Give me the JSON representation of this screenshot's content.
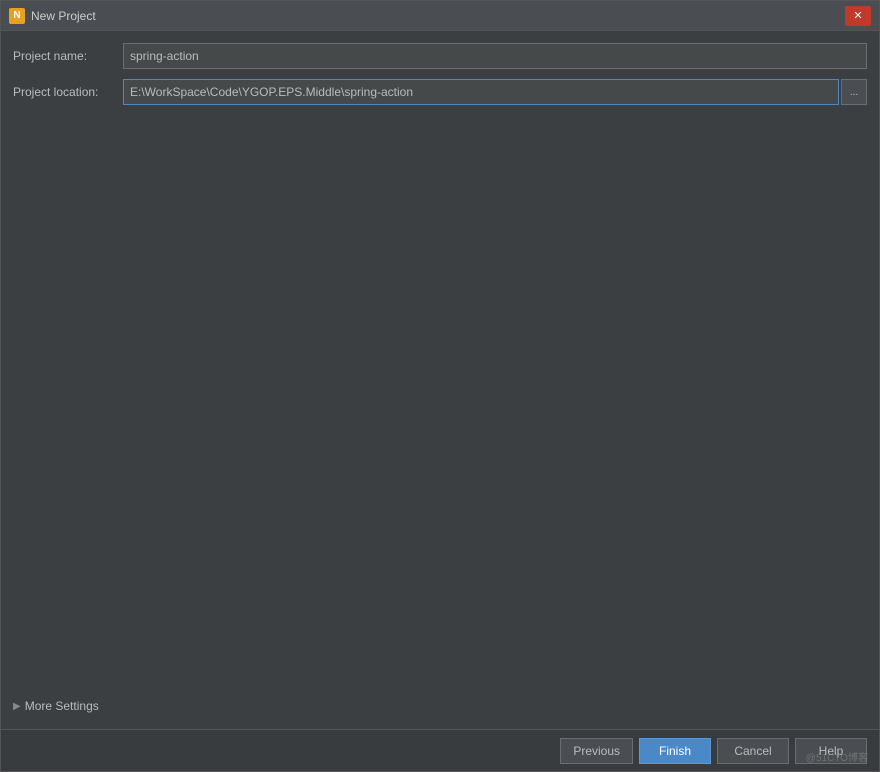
{
  "window": {
    "title": "New Project",
    "icon_label": "N"
  },
  "titlebar": {
    "controls": {
      "close_label": "✕"
    }
  },
  "form": {
    "project_name_label": "Project name:",
    "project_name_value": "spring-action",
    "project_location_label": "Project location:",
    "project_location_value": "E:\\WorkSpace\\Code\\YGOP.EPS.Middle\\spring-action",
    "browse_label": "..."
  },
  "more_settings": {
    "label": "More Settings",
    "arrow": "▶"
  },
  "buttons": {
    "previous_label": "Previous",
    "finish_label": "Finish",
    "cancel_label": "Cancel",
    "help_label": "Help"
  },
  "watermark": {
    "text": "@51CTO博客"
  }
}
